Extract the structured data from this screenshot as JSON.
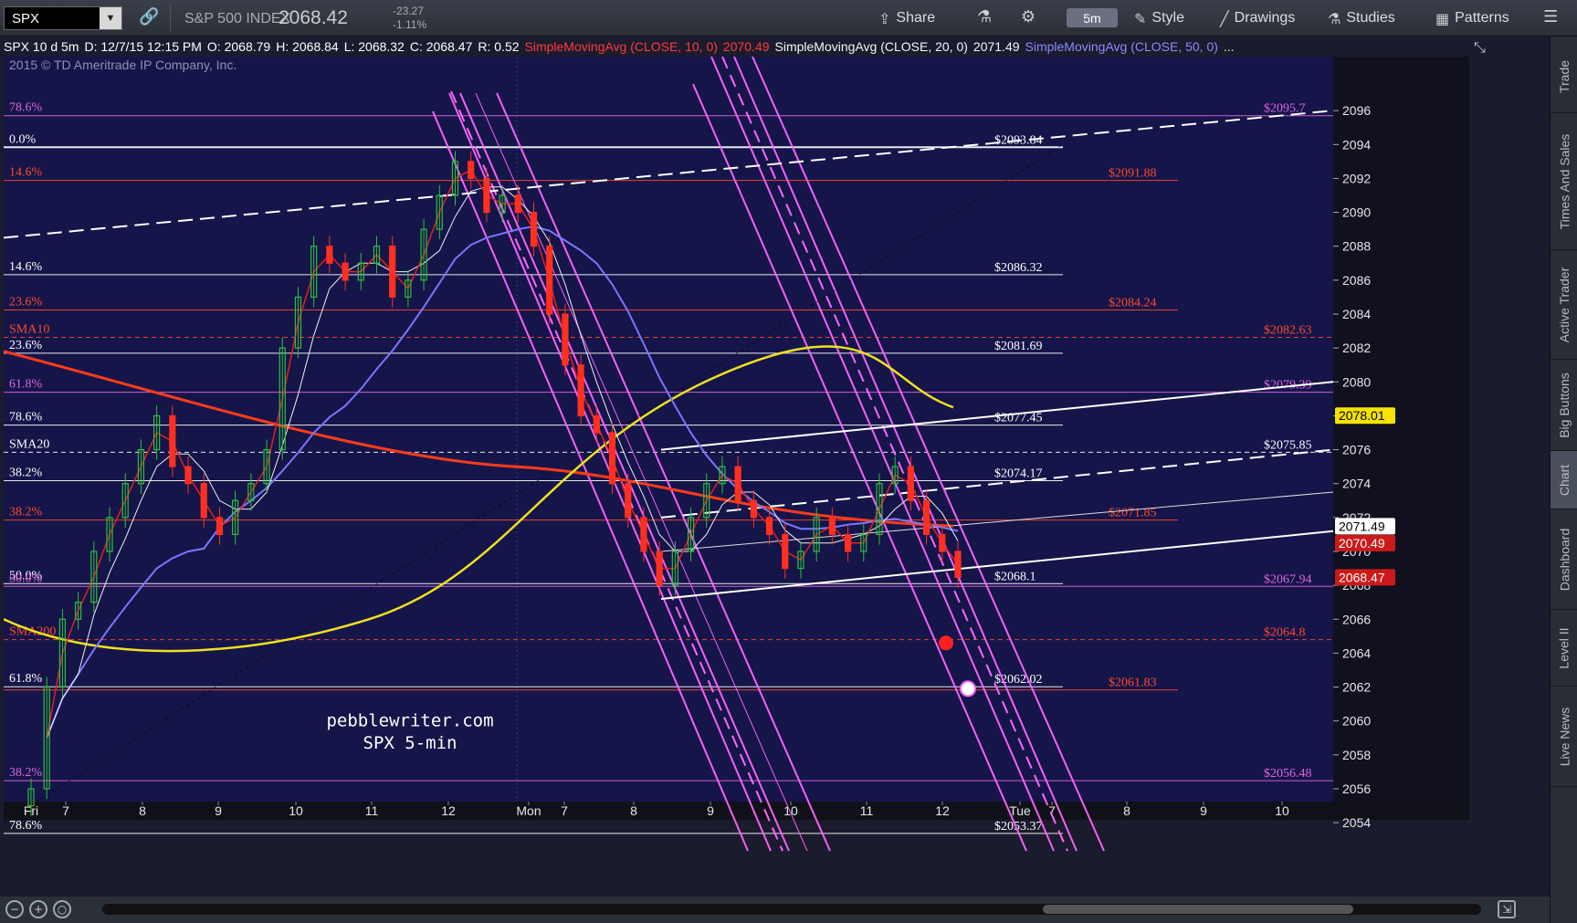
{
  "toolbar": {
    "symbol": "SPX",
    "index_name": "S&P 500 INDEX",
    "price": "2068.42",
    "change": "-23.27",
    "change_pct": "-1.11%",
    "share_label": "Share",
    "interval": "5m",
    "style_label": "Style",
    "drawings_label": "Drawings",
    "studies_label": "Studies",
    "patterns_label": "Patterns"
  },
  "infoline": {
    "desc": "SPX 10 d 5m",
    "date": "D: 12/7/15 12:15 PM",
    "open": "O: 2068.79",
    "high": "H: 2068.84",
    "low": "L: 2068.32",
    "close": "C: 2068.47",
    "range": "R: 0.52",
    "sma10": "SimpleMovingAvg (CLOSE, 10, 0)",
    "sma10_val": "2070.49",
    "sma20": "SimpleMovingAvg (CLOSE, 20, 0)",
    "sma20_val": "2071.49",
    "sma50": "SimpleMovingAvg (CLOSE, 50, 0)",
    "more": "..."
  },
  "copyright": "2015 © TD Ameritrade IP Company, Inc.",
  "annotation_site": "pebblewriter.com",
  "annotation_title": "SPX 5-min",
  "side_tabs": [
    "Trade",
    "Times And Sales",
    "Active Trader",
    "Big Buttons",
    "Chart",
    "Dashboard",
    "Level II",
    "Live News"
  ],
  "chart_data": {
    "type": "candlestick",
    "ylim": [
      2053,
      2098
    ],
    "y_ticks": [
      2054,
      2056,
      2058,
      2060,
      2062,
      2064,
      2066,
      2068,
      2070,
      2072,
      2074,
      2076,
      2078,
      2080,
      2082,
      2084,
      2086,
      2088,
      2090,
      2092,
      2094,
      2096
    ],
    "x_tick_labels": [
      "Fri",
      "7",
      "8",
      "9",
      "10",
      "11",
      "12",
      "Mon",
      "7",
      "8",
      "9",
      "10",
      "11",
      "12",
      "Tue",
      "7",
      "8",
      "9",
      "10"
    ],
    "closes": [
      2056,
      2062,
      2066,
      2067,
      2070,
      2072,
      2074,
      2076,
      2078,
      2075,
      2074,
      2072,
      2071,
      2073,
      2074,
      2076,
      2082,
      2085,
      2088,
      2087,
      2086,
      2087,
      2088,
      2085,
      2086,
      2089,
      2091,
      2093,
      2092,
      2090,
      2091,
      2090,
      2088,
      2084,
      2081,
      2078,
      2077,
      2074,
      2072,
      2070,
      2068,
      2070,
      2072,
      2074,
      2075,
      2073,
      2072,
      2071,
      2069,
      2070,
      2072,
      2071,
      2070,
      2071,
      2074,
      2075,
      2073,
      2071,
      2070,
      2068.47
    ],
    "price_levels": [
      {
        "value": 2095.7,
        "label": "$2095.7",
        "color": "#e066e0",
        "left": "78.6%"
      },
      {
        "value": 2093.84,
        "label": "$2093.84",
        "color": "#ffffff",
        "left": "0.0%"
      },
      {
        "value": 2091.88,
        "label": "$2091.88",
        "color": "#ff4a2a",
        "left": "14.6%"
      },
      {
        "value": 2086.32,
        "label": "$2086.32",
        "color": "#ffffff",
        "left": "14.6%"
      },
      {
        "value": 2084.24,
        "label": "$2084.24",
        "color": "#ff4a2a",
        "left": "23.6%"
      },
      {
        "value": 2082.63,
        "label": "$2082.63",
        "color": "#ff4a2a",
        "left": "SMA10",
        "dashed": true
      },
      {
        "value": 2081.69,
        "label": "$2081.69",
        "color": "#ffffff",
        "left": "23.6%"
      },
      {
        "value": 2079.39,
        "label": "$2079.39",
        "color": "#e066e0",
        "left": "61.8%"
      },
      {
        "value": 2077.45,
        "label": "$2077.45",
        "color": "#ffffff",
        "left": "78.6%"
      },
      {
        "value": 2075.85,
        "label": "$2075.85",
        "color": "#ffffff",
        "left": "SMA20",
        "dashed": true
      },
      {
        "value": 2074.17,
        "label": "$2074.17",
        "color": "#ffffff",
        "left": "38.2%"
      },
      {
        "value": 2071.85,
        "label": "$2071.85",
        "color": "#ff4a2a",
        "left": "38.2%"
      },
      {
        "value": 2068.1,
        "label": "$2068.1",
        "color": "#ffffff",
        "left": "50.0%"
      },
      {
        "value": 2067.94,
        "label": "$2067.94",
        "color": "#e066e0",
        "left": "50.0%"
      },
      {
        "value": 2064.8,
        "label": "$2064.8",
        "color": "#ff4a2a",
        "left": "SMA200",
        "dashed": true
      },
      {
        "value": 2062.02,
        "label": "$2062.02",
        "color": "#ffffff",
        "left": "61.8%"
      },
      {
        "value": 2061.83,
        "label": "$2061.83",
        "color": "#ff4a2a",
        "left": ""
      },
      {
        "value": 2056.48,
        "label": "$2056.48",
        "color": "#e066e0",
        "left": "38.2%"
      },
      {
        "value": 2053.37,
        "label": "$2053.37",
        "color": "#ffffff",
        "left": "78.6%"
      }
    ],
    "price_tags": [
      {
        "value": 2078.01,
        "label": "2078.01",
        "bg": "#f5e200",
        "fg": "#000000"
      },
      {
        "value": 2071.49,
        "label": "2071.49",
        "bg": "#ffffff",
        "fg": "#000000"
      },
      {
        "value": 2070.49,
        "label": "2070.49",
        "bg": "#cc1a1a",
        "fg": "#ffffff"
      },
      {
        "value": 2068.47,
        "label": "2068.47",
        "bg": "#cc1a1a",
        "fg": "#ffffff"
      }
    ],
    "colors": {
      "background": "#15154a",
      "up_candle": "#2fbf3a",
      "down_candle": "#ff3020",
      "sma10": "#e02020",
      "sma20": "#f0f0f0",
      "sma50": "#7878ff",
      "sma200_red": "#ff3b1a",
      "sma200_yellow": "#f0e020",
      "channel": "#ff66ff"
    }
  }
}
